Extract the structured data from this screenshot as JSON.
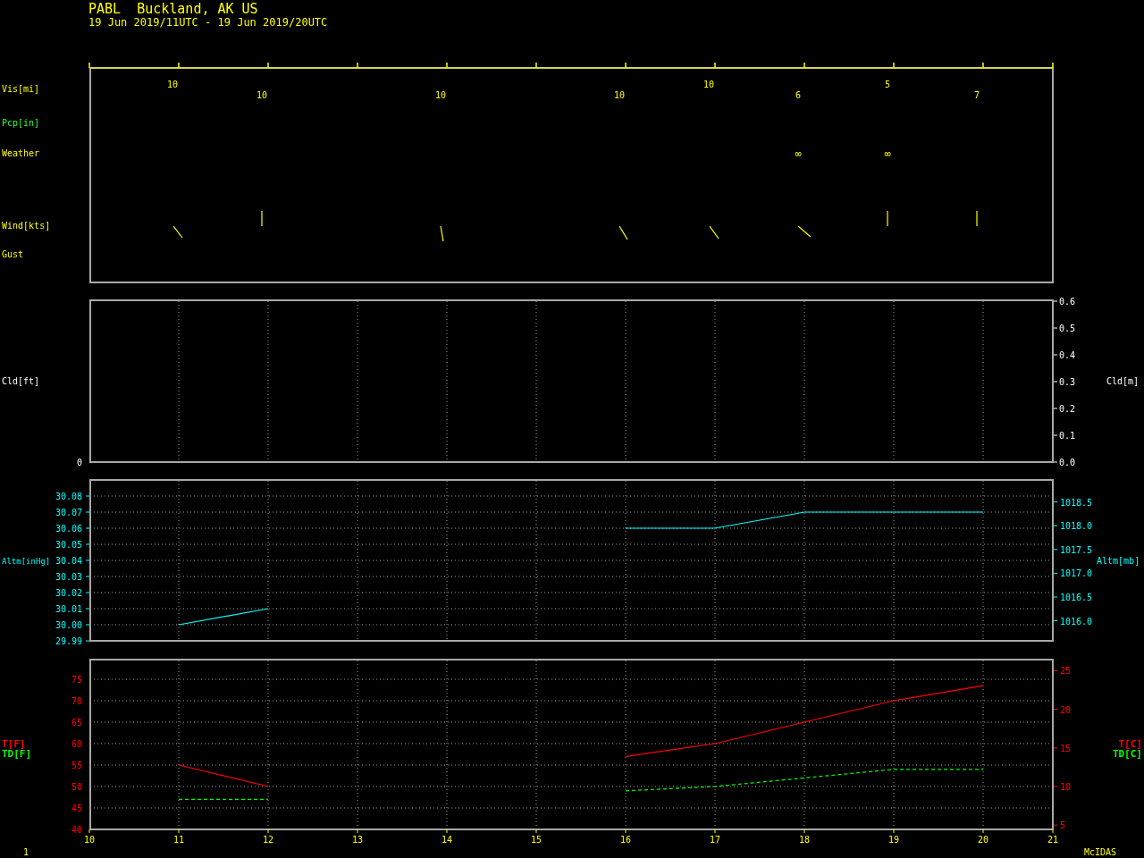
{
  "header": {
    "title": "PABL  Buckland, AK US",
    "period": "19 Jun 2019/11UTC - 19 Jun 2019/20UTC"
  },
  "obs_panel": {
    "row_labels": [
      {
        "text": "Vis[mi]",
        "kind": "vis"
      },
      {
        "text": "Pcp[in]",
        "kind": "pcp"
      },
      {
        "text": "Weather",
        "kind": "weather"
      },
      {
        "text": "Wind[kts]",
        "kind": "wind"
      },
      {
        "text": "Gust",
        "kind": "gust"
      }
    ],
    "time_slots": [
      {
        "kind": "report",
        "visibility": "10"
      },
      {
        "kind": "report",
        "visibility": "10"
      },
      {
        "kind": "empty"
      },
      {
        "kind": "report",
        "visibility": "10"
      },
      {
        "kind": "empty"
      },
      {
        "kind": "report",
        "visibility": "10"
      },
      {
        "kind": "report",
        "visibility": "10"
      },
      {
        "kind": "report",
        "visibility": "6",
        "weather": "∞"
      },
      {
        "kind": "report",
        "visibility": "5",
        "weather": "∞"
      },
      {
        "kind": "report",
        "visibility": "7"
      }
    ]
  },
  "cloud_panel": {
    "left_label": "Cld[ft]",
    "left_ticks": [
      "0"
    ],
    "right_label": "Cld[m]",
    "right_ticks": [
      "0.6",
      "0.5",
      "0.4",
      "0.3",
      "0.2",
      "0.1",
      "0.0"
    ]
  },
  "altimeter_panel": {
    "left_label": "Altm[inHg]",
    "right_label": "Altm[mb]",
    "right_ticks": [
      "1018.5",
      "1018.0",
      "1017.5",
      "1017.0",
      "1016.5",
      "1016.0"
    ],
    "chart_data": {
      "type": "line",
      "x": [
        11,
        12,
        13,
        14,
        15,
        16,
        17,
        18,
        19,
        20
      ],
      "series": [
        {
          "color": "#00ffff",
          "line_style": "solid",
          "values": [
            30.0,
            30.01,
            null,
            null,
            null,
            30.06,
            30.06,
            30.07,
            30.07,
            30.07
          ]
        }
      ],
      "xlim": [
        10,
        20.78
      ],
      "ylim": [
        29.99,
        30.09
      ],
      "grid": true,
      "yticks": [
        {
          "value": 29.99,
          "label": "29.99"
        },
        {
          "value": 30.0,
          "label": "30.00"
        },
        {
          "value": 30.01,
          "label": "30.01"
        },
        {
          "value": 30.02,
          "label": "30.02"
        },
        {
          "value": 30.03,
          "label": "30.03"
        },
        {
          "value": 30.04,
          "label": "30.04"
        },
        {
          "value": 30.05,
          "label": "30.05"
        },
        {
          "value": 30.06,
          "label": "30.06"
        },
        {
          "value": 30.07,
          "label": "30.07"
        },
        {
          "value": 30.08,
          "label": "30.08"
        }
      ]
    }
  },
  "temperature_panel": {
    "left_labels": [
      {
        "text": "T[F]",
        "color": "#ff0000"
      },
      {
        "text": "TD[F]",
        "color": "#00ff00"
      }
    ],
    "right_labels": [
      {
        "text": "T[C]",
        "color": "#ff0000"
      },
      {
        "text": "TD[C]",
        "color": "#00ff00"
      }
    ],
    "right_ticks": [
      "25",
      "20",
      "15",
      "10",
      "5"
    ],
    "chart_data": {
      "type": "line",
      "x": [
        11,
        12,
        13,
        14,
        15,
        16,
        17,
        18,
        19,
        20
      ],
      "series": [
        {
          "color": "#ff0000",
          "line_style": "solid",
          "values": [
            55,
            50,
            null,
            null,
            null,
            57,
            60,
            65,
            70,
            73.5
          ]
        },
        {
          "color": "#00ff00",
          "line_style": "dashed",
          "values": [
            47,
            47,
            null,
            null,
            null,
            49,
            50,
            52,
            54,
            54
          ]
        }
      ],
      "xlim": [
        10,
        20.78
      ],
      "ylim": [
        40,
        80
      ],
      "grid": true,
      "xticks": [
        10,
        11,
        12,
        13,
        14,
        15,
        16,
        17,
        18,
        19,
        20,
        {
          "value": 20.78,
          "label": "21"
        }
      ],
      "yticks": [
        40,
        45,
        50,
        55,
        60,
        65,
        70,
        75
      ]
    }
  },
  "footer": {
    "page_number": "1",
    "brand": "McIDAS"
  }
}
